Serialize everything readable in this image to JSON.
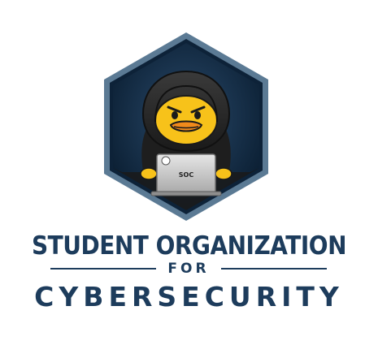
{
  "logo": {
    "icon": "hooded-duck-hacker-icon",
    "laptop_label": "SOC"
  },
  "title": {
    "line1": "STUDENT ORGANIZATION",
    "line2": "FOR",
    "line3": "CYBERSECURITY"
  },
  "colors": {
    "brand_navy": "#1d3c5c",
    "hex_border": "#5b7a94",
    "hex_fill": "#0f2740",
    "duck_yellow": "#f7c21a",
    "duck_beak": "#f08a1c",
    "laptop_silver": "#c9c9c9"
  }
}
